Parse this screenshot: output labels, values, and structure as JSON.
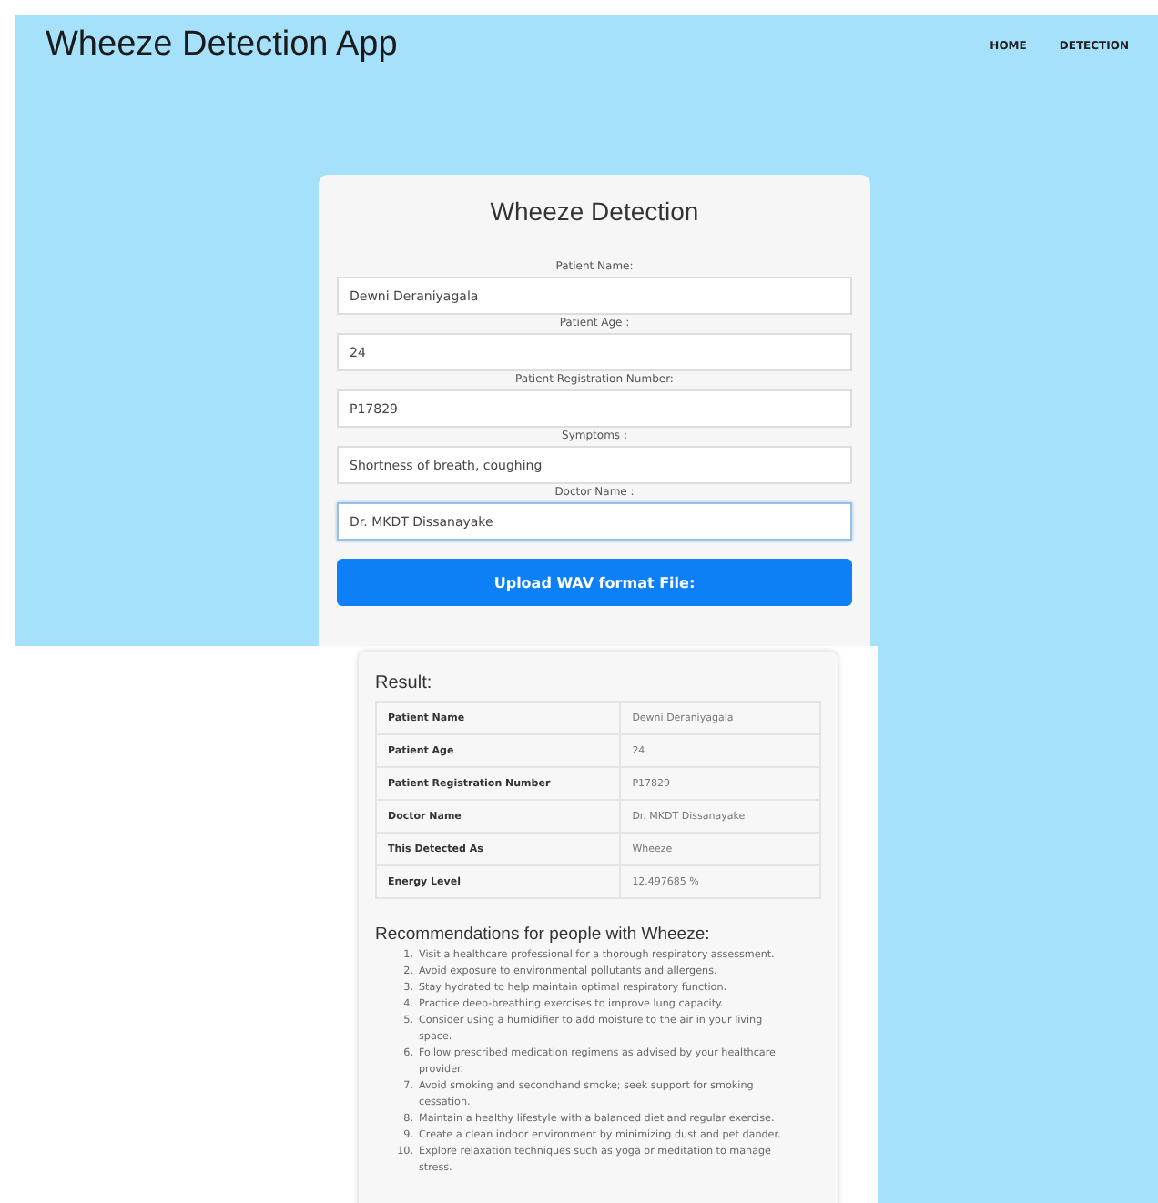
{
  "header": {
    "title": "Wheeze Detection App",
    "nav": [
      {
        "label": "HOME"
      },
      {
        "label": "DETECTION"
      }
    ]
  },
  "form": {
    "title": "Wheeze Detection",
    "fields": [
      {
        "label": "Patient Name:",
        "value": "Dewni Deraniyagala",
        "focused": false
      },
      {
        "label": "Patient Age :",
        "value": "24",
        "focused": false
      },
      {
        "label": "Patient Registration Number:",
        "value": "P17829",
        "focused": false
      },
      {
        "label": "Symptoms :",
        "value": "Shortness of breath, coughing",
        "focused": false
      },
      {
        "label": "Doctor Name :",
        "value": "Dr. MKDT Dissanayake",
        "focused": true
      }
    ],
    "button": "Upload WAV format File:"
  },
  "result": {
    "title": "Result:",
    "rows": [
      {
        "label": "Patient Name",
        "value": "Dewni Deraniyagala"
      },
      {
        "label": "Patient Age",
        "value": "24"
      },
      {
        "label": "Patient Registration Number",
        "value": "P17829"
      },
      {
        "label": "Doctor Name",
        "value": "Dr. MKDT Dissanayake"
      },
      {
        "label": "This Detected As",
        "value": "Wheeze"
      },
      {
        "label": "Energy Level",
        "value": "12.497685 %"
      }
    ],
    "recommendations_title": "Recommendations for people with Wheeze:",
    "recommendations": [
      {
        "number": "1.",
        "text": "Visit a healthcare professional for a thorough respiratory assessment."
      },
      {
        "number": "2.",
        "text": "Avoid exposure to environmental pollutants and allergens."
      },
      {
        "number": "3.",
        "text": "Stay hydrated to help maintain optimal respiratory function."
      },
      {
        "number": "4.",
        "text": "Practice deep-breathing exercises to improve lung capacity."
      },
      {
        "number": "5.",
        "text": "Consider using a humidifier to add moisture to the air in your living space."
      },
      {
        "number": "6.",
        "text": "Follow prescribed medication regimens as advised by your healthcare provider."
      },
      {
        "number": "7.",
        "text": "Avoid smoking and secondhand smoke; seek support for smoking cessation."
      },
      {
        "number": "8.",
        "text": "Maintain a healthy lifestyle with a balanced diet and regular exercise."
      },
      {
        "number": "9.",
        "text": "Create a clean indoor environment by minimizing dust and pet dander."
      },
      {
        "number": "10.",
        "text": "Explore relaxation techniques such as yoga or meditation to manage stress."
      }
    ]
  }
}
